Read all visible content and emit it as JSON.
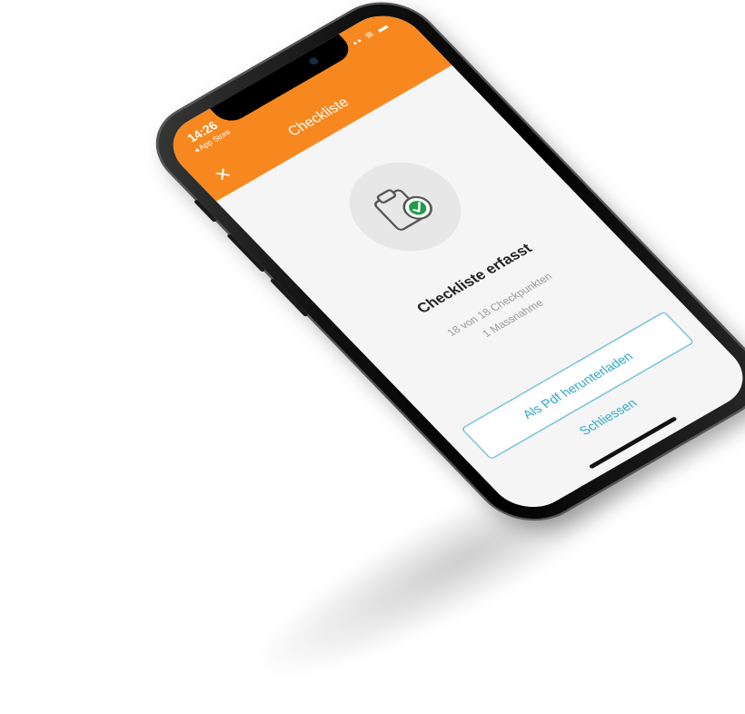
{
  "status_bar": {
    "time": "14:26",
    "back_label": "◂ App Store",
    "icons_text": "▪▪ ≋ ▬"
  },
  "navbar": {
    "title": "Checkliste",
    "close_icon": "✕",
    "color": "#f7881f"
  },
  "content": {
    "headline": "Checkliste erfasst",
    "checkpoints_text": "18 von 18 Checkpunkten",
    "measures_text": "1 Massnahme"
  },
  "buttons": {
    "download_pdf": "Als Pdf herunterladen",
    "close": "Schliessen"
  },
  "colors": {
    "accent": "#2fa8c8",
    "check_green": "#1e9e4a"
  }
}
